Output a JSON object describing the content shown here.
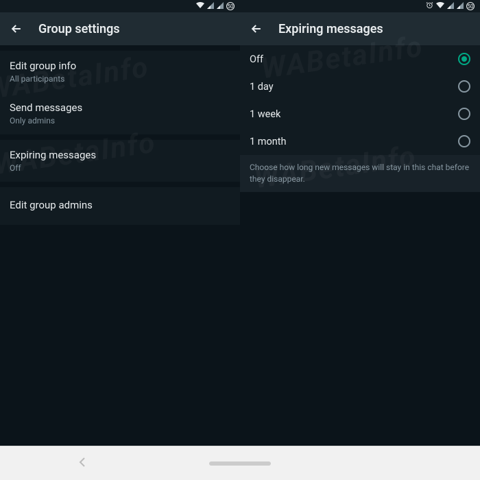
{
  "left": {
    "header": "Group settings",
    "items": [
      {
        "title": "Edit group info",
        "subtitle": "All participants"
      },
      {
        "title": "Send messages",
        "subtitle": "Only admins"
      },
      {
        "title": "Expiring messages",
        "subtitle": "Off"
      },
      {
        "title": "Edit group admins",
        "subtitle": ""
      }
    ]
  },
  "right": {
    "header": "Expiring messages",
    "options": [
      "Off",
      "1 day",
      "1 week",
      "1 month"
    ],
    "selected": "Off",
    "footer": "Choose how long new messages will stay in this chat before they disappear."
  },
  "status": {
    "battery": "50"
  },
  "watermark": "WABetaInfo"
}
